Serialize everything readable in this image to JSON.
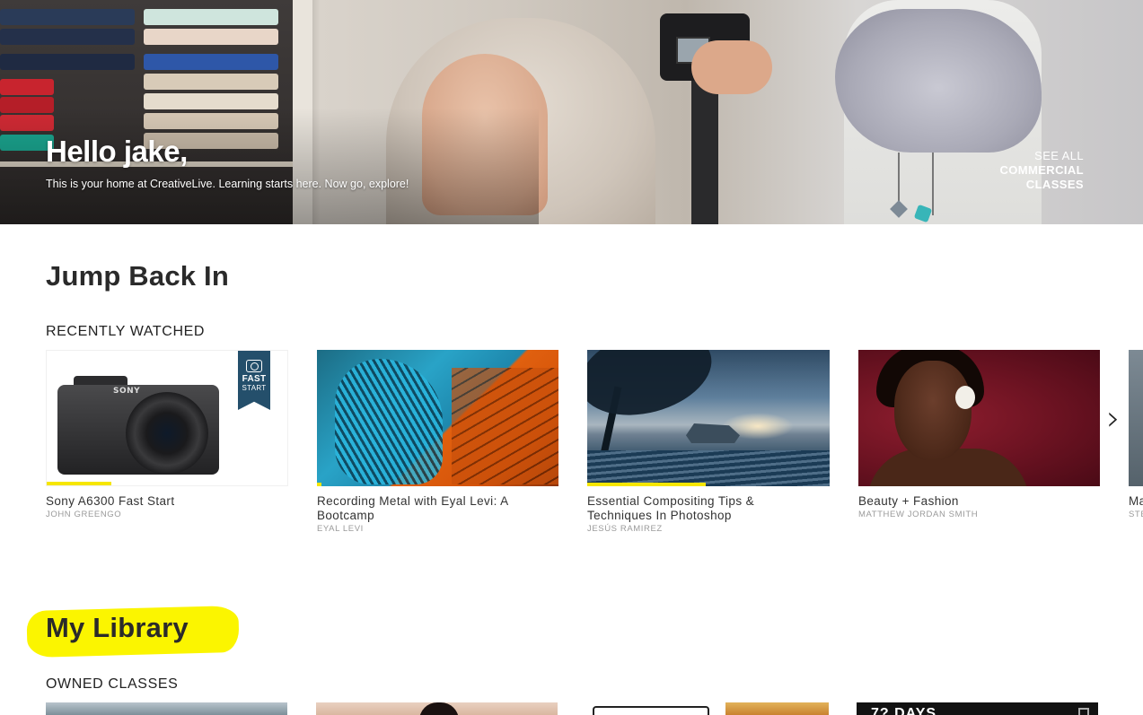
{
  "hero": {
    "greeting": "Hello jake,",
    "subtitle": "This is your home at CreativeLive. Learning starts here. Now go, explore!",
    "cta_line1": "SEE ALL",
    "cta_line2": "COMMERCIAL",
    "cta_line3": "CLASSES"
  },
  "jump_back_in": {
    "title": "Jump Back In",
    "subtitle": "RECENTLY WATCHED",
    "cards": [
      {
        "title_line1": "Sony A6300 Fast Start",
        "title_line2": "",
        "author": "JOHN GREENGO",
        "progress": 0.27,
        "badge_line1": "FAST",
        "badge_line2": "START",
        "brand": "SONY"
      },
      {
        "title_line1": "Recording Metal with Eyal Levi: A",
        "title_line2": "Bootcamp",
        "author": "EYAL LEVI",
        "progress": 0.02
      },
      {
        "title_line1": "Essential Compositing Tips &",
        "title_line2": "Techniques In Photoshop",
        "author": "JESÚS RAMIREZ",
        "progress": 0.49
      },
      {
        "title_line1": "Beauty + Fashion",
        "title_line2": "",
        "author": "MATTHEW JORDAN SMITH",
        "progress": 0
      },
      {
        "title_line1": "Ma",
        "title_line2": "",
        "author": "STE",
        "progress": 0
      }
    ],
    "next_icon": "chevron-right-icon"
  },
  "my_library": {
    "title": "My Library",
    "subtitle": "OWNED CLASSES",
    "owned_partial_text": "7? DAYS"
  },
  "colors": {
    "progress": "#f6e600",
    "highlight": "#fbf500",
    "badge": "#244f6b"
  }
}
